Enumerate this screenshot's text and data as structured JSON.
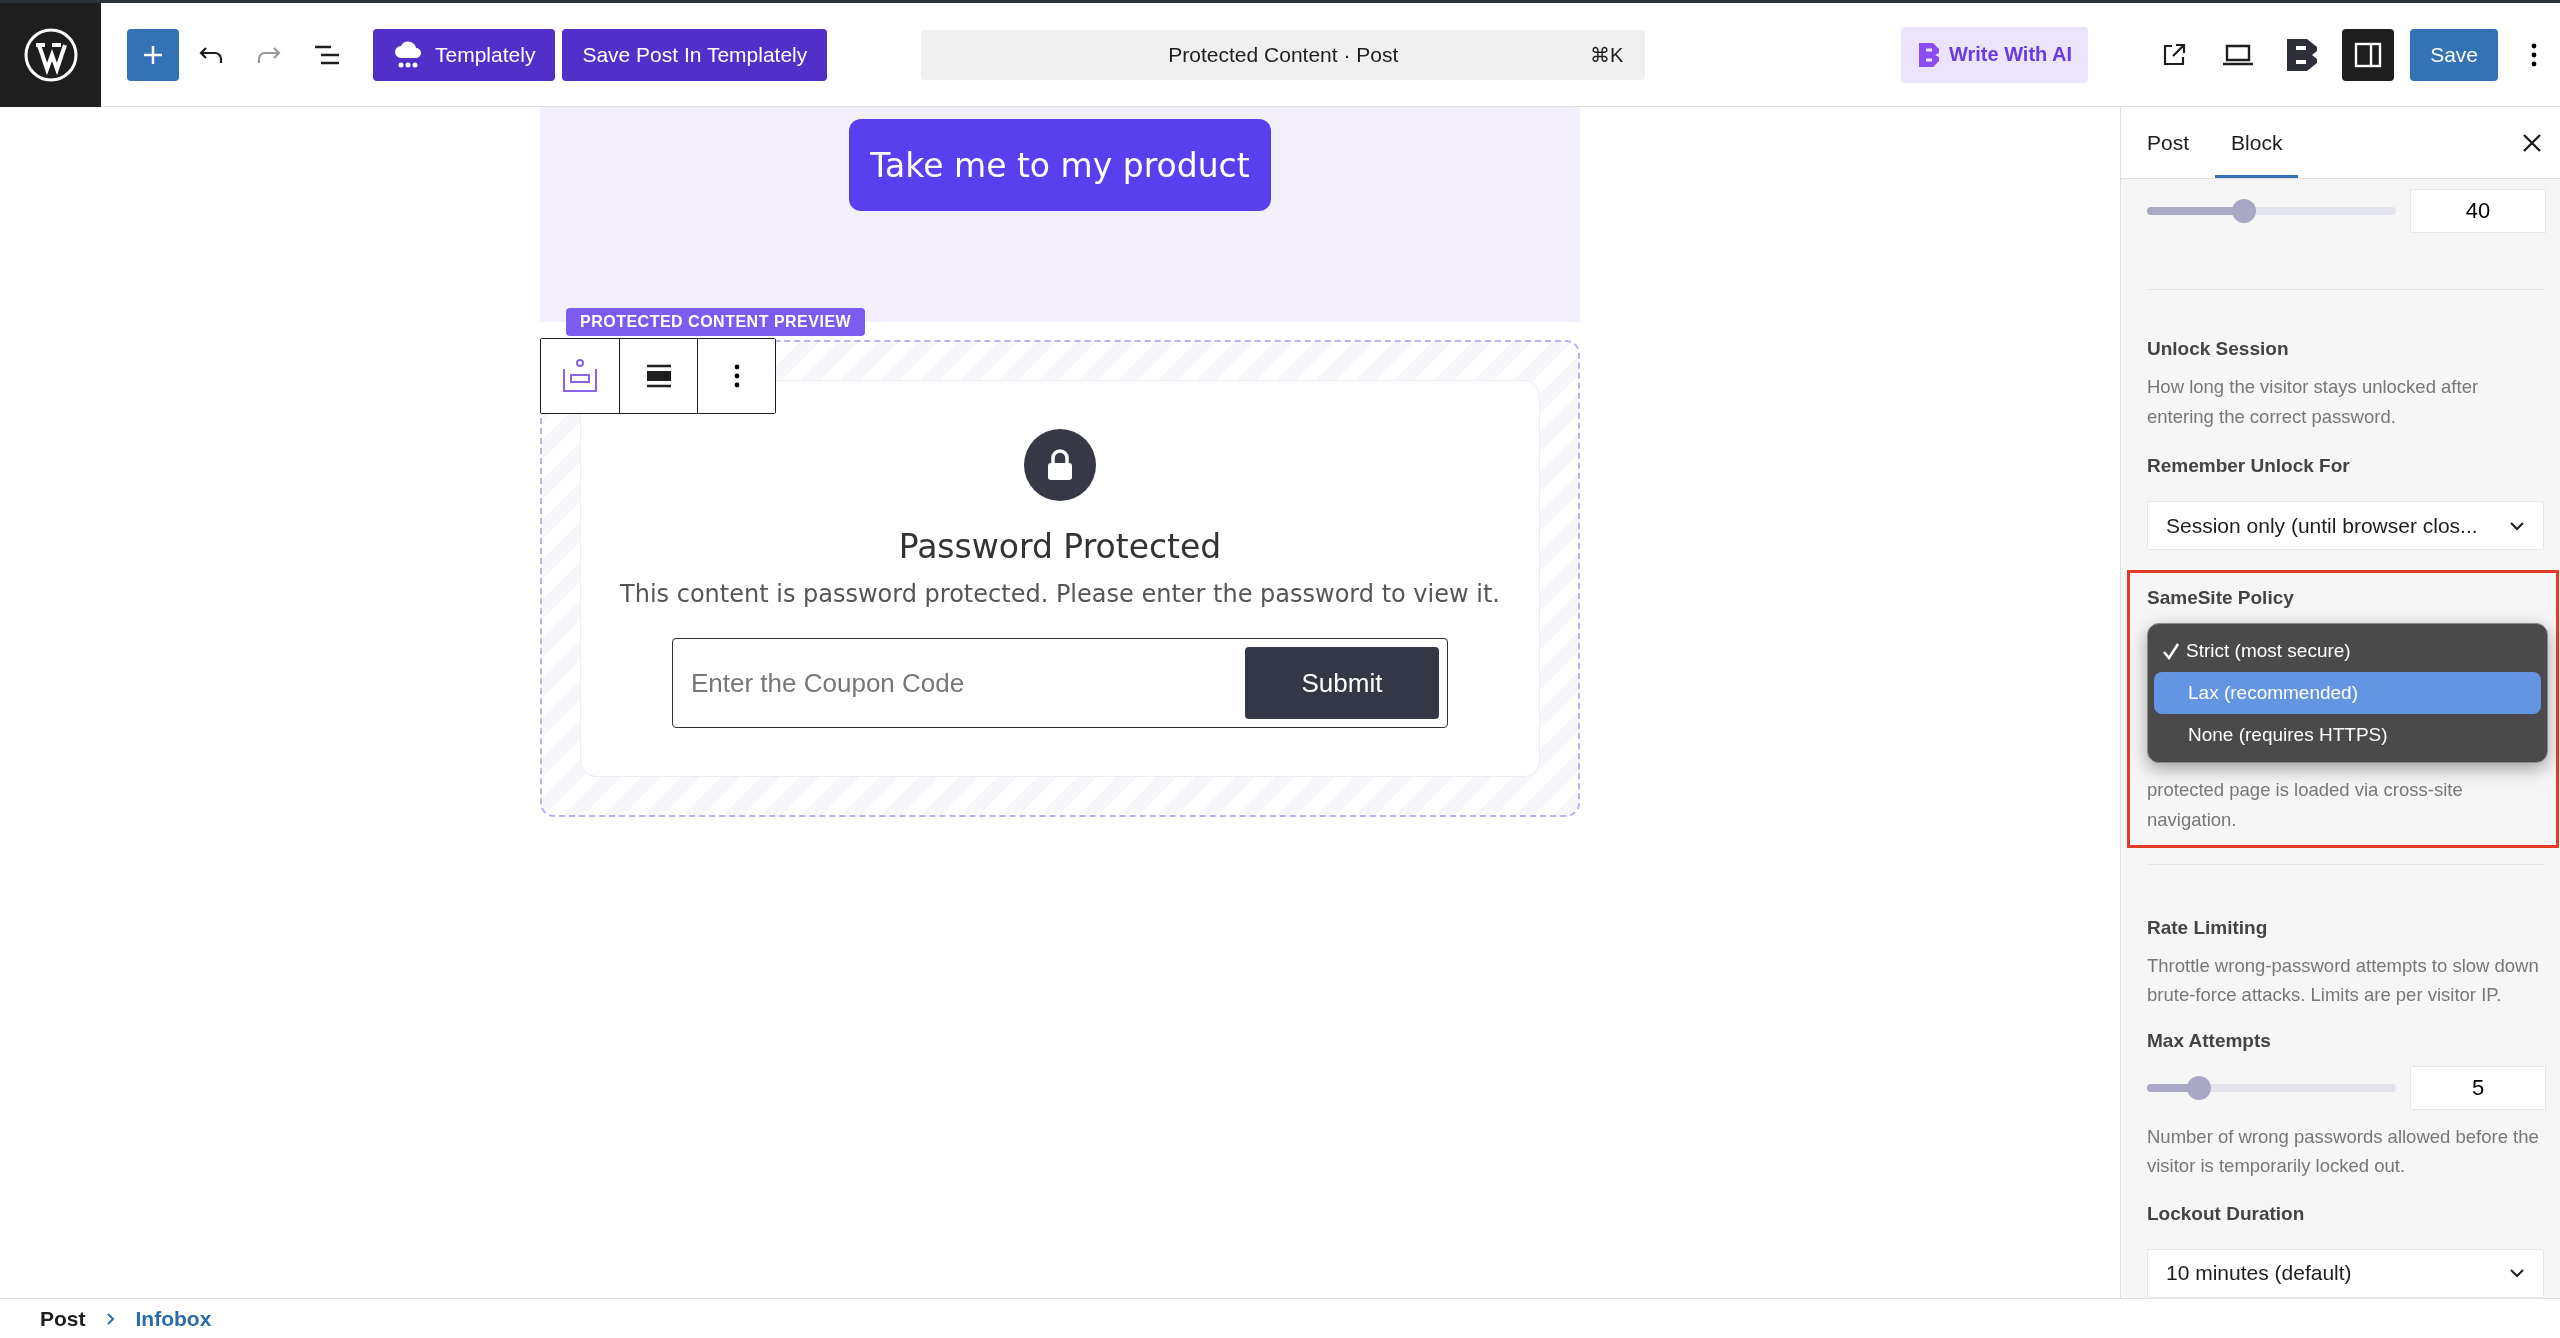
{
  "toolbar": {
    "templately": "Templately",
    "save_templately": "Save Post In Templately",
    "command": "Protected Content · Post",
    "shortcut": "⌘K",
    "write_ai": "Write With AI",
    "save": "Save"
  },
  "canvas": {
    "product_button": "Take me to my product",
    "badge": "PROTECTED CONTENT PREVIEW",
    "heading": "Password Protected",
    "message": "This content is password protected. Please enter the password to view it.",
    "input_placeholder": "Enter the Coupon Code",
    "submit": "Submit"
  },
  "sidebar": {
    "tabs": [
      {
        "label": "Post",
        "selected": false
      },
      {
        "label": "Block",
        "selected": true
      }
    ],
    "top_slider": {
      "level": 0.39,
      "value": "40"
    },
    "unlock": {
      "title": "Unlock Session",
      "description": "How long the visitor stays unlocked after entering the correct password.",
      "field_label": "Remember Unlock For",
      "value": "Session only (until browser clos..."
    },
    "samesite": {
      "label": "SameSite Policy",
      "options": [
        {
          "label": "Strict (most secure)",
          "selected": true,
          "highlighted": false
        },
        {
          "label": "Lax (recommended)",
          "selected": false,
          "highlighted": true
        },
        {
          "label": "None (requires HTTPS)",
          "selected": false,
          "highlighted": false
        }
      ],
      "description": "protected page is loaded via cross-site navigation."
    },
    "rate": {
      "title": "Rate Limiting",
      "description": "Throttle wrong-password attempts to slow down brute-force attacks. Limits are per visitor IP.",
      "field_label": "Max Attempts",
      "slider": {
        "level": 0.21,
        "value": "5"
      },
      "hint": "Number of wrong passwords allowed before the visitor is temporarily locked out.",
      "lockout_label": "Lockout Duration",
      "lockout_value": "10 minutes (default)"
    }
  },
  "breadcrumb": [
    {
      "label": "Post",
      "current": false
    },
    {
      "label": "Infobox",
      "current": true
    }
  ]
}
